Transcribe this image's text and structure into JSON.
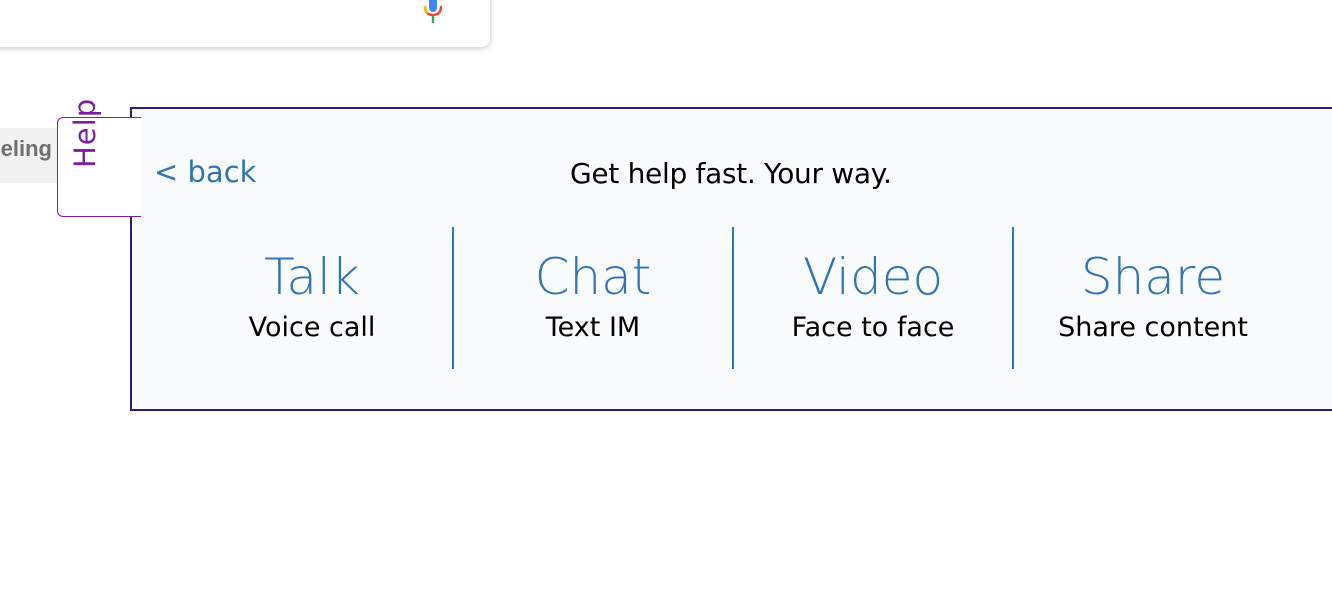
{
  "search": {
    "mic_icon": "microphone-icon"
  },
  "partial_button": {
    "label": "eling"
  },
  "help_tab": {
    "label": "Help",
    "color": "#7b1fa2"
  },
  "panel": {
    "back_label": "< back",
    "title": "Get help fast. Your way.",
    "accent_color": "#2f74b5",
    "border_color": "#2a1a8c",
    "options": [
      {
        "title": "Talk",
        "subtitle": "Voice call"
      },
      {
        "title": "Chat",
        "subtitle": "Text IM"
      },
      {
        "title": "Video",
        "subtitle": "Face to face"
      },
      {
        "title": "Share",
        "subtitle": "Share content"
      }
    ]
  }
}
